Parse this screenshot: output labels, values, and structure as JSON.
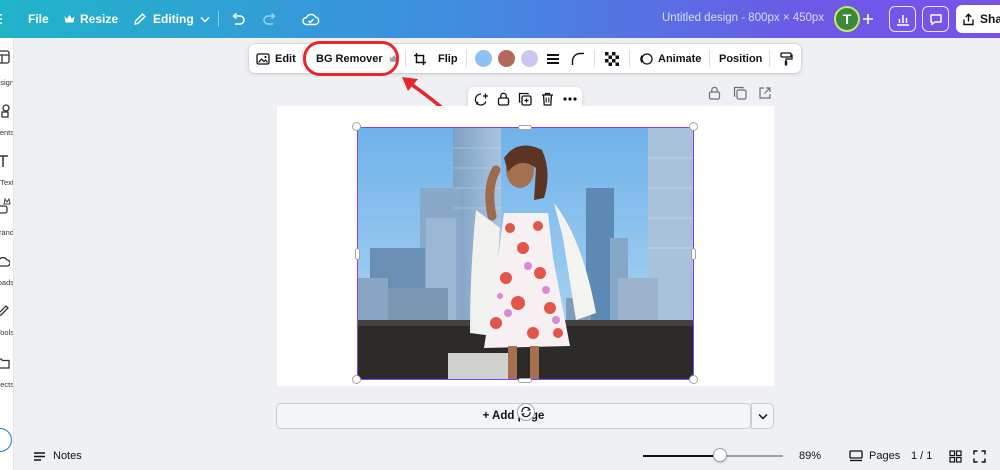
{
  "topbar": {
    "file_label": "File",
    "resize_label": "Resize",
    "editing_label": "Editing",
    "design_title": "Untitled design - 800px × 450px",
    "avatar_initial": "T",
    "share_label": "Share"
  },
  "leftrail": {
    "items": [
      {
        "label": "Design",
        "icon": "layout-icon"
      },
      {
        "label": "Elements",
        "icon": "shapes-icon"
      },
      {
        "label": "Text",
        "icon": "text-icon"
      },
      {
        "label": "Brand",
        "icon": "crown-icon"
      },
      {
        "label": "Uploads",
        "icon": "cloud-upload-icon"
      },
      {
        "label": "Tools",
        "icon": "pencil-icon"
      },
      {
        "label": "Projects",
        "icon": "folder-icon"
      }
    ]
  },
  "toolbar": {
    "edit_label": "Edit",
    "bg_remover_label": "BG Remover",
    "flip_label": "Flip",
    "animate_label": "Animate",
    "position_label": "Position",
    "swatches": [
      "#8ec0f0",
      "#b5675a",
      "#cfc6ee"
    ]
  },
  "canvas": {
    "add_page_label": "+ Add page"
  },
  "bottombar": {
    "notes_label": "Notes",
    "zoom_percent": "89%",
    "zoom_value": 0.55,
    "pages_label": "Pages",
    "page_count": "1 / 1"
  },
  "colors": {
    "highlight": "#e8262c",
    "selection": "#8b3dff"
  }
}
